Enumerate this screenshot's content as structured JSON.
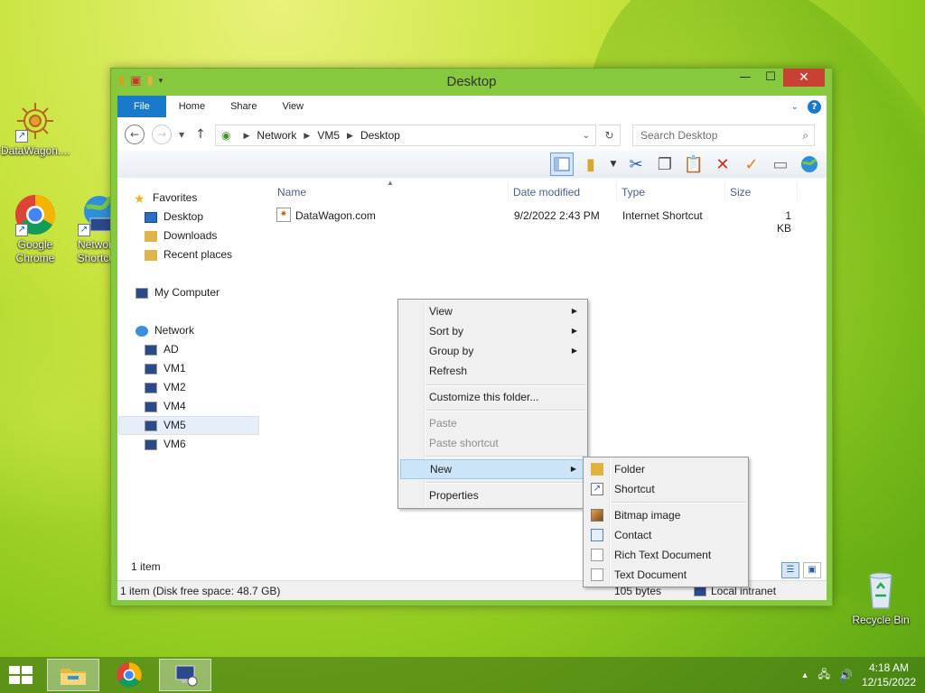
{
  "desktop": {
    "icons": [
      {
        "label": "DataWagon....",
        "lines": [
          "DataWagon...."
        ]
      },
      {
        "label": "Google Chrome",
        "lines": [
          "Google",
          "Chrome"
        ]
      },
      {
        "label": "Network Shortcut",
        "lines": [
          "Network",
          "Shortcut"
        ]
      },
      {
        "label": "Recycle Bin",
        "lines": [
          "Recycle Bin"
        ]
      }
    ]
  },
  "window": {
    "title": "Desktop",
    "buttons": {
      "minimize": "—",
      "maximize": "☐",
      "close": "✕"
    },
    "ribbon_tabs": [
      "File",
      "Home",
      "Share",
      "View"
    ],
    "address": {
      "segments": [
        "Network",
        "VM5",
        "Desktop"
      ]
    },
    "search_placeholder": "Search Desktop"
  },
  "nav": {
    "favorites": {
      "label": "Favorites",
      "items": [
        "Desktop",
        "Downloads",
        "Recent places"
      ]
    },
    "computer": "My Computer",
    "network": {
      "label": "Network",
      "items": [
        "AD",
        "VM1",
        "VM2",
        "VM4",
        "VM5",
        "VM6"
      ],
      "selected": "VM5"
    }
  },
  "files": {
    "columns": [
      "Name",
      "Date modified",
      "Type",
      "Size"
    ],
    "rows": [
      {
        "name": "DataWagon.com",
        "date": "9/2/2022 2:43 PM",
        "type": "Internet Shortcut",
        "size": "1 KB"
      }
    ],
    "item_count": "1 item"
  },
  "status": {
    "left": "1 item (Disk free space: 48.7 GB)",
    "size": "105 bytes",
    "zone": "Local intranet"
  },
  "context_menu": {
    "items": [
      "View",
      "Sort by",
      "Group by",
      "Refresh",
      "Customize this folder...",
      "Paste",
      "Paste shortcut",
      "New",
      "Properties"
    ],
    "highlighted": "New"
  },
  "submenu_new": {
    "items": [
      "Folder",
      "Shortcut",
      "Bitmap image",
      "Contact",
      "Rich Text Document",
      "Text Document"
    ]
  },
  "taskbar": {
    "time": "4:18 AM",
    "date": "12/15/2022"
  },
  "colors": {
    "accent": "#1979ca",
    "close": "#c94133",
    "highlight": "#cce4f7"
  }
}
